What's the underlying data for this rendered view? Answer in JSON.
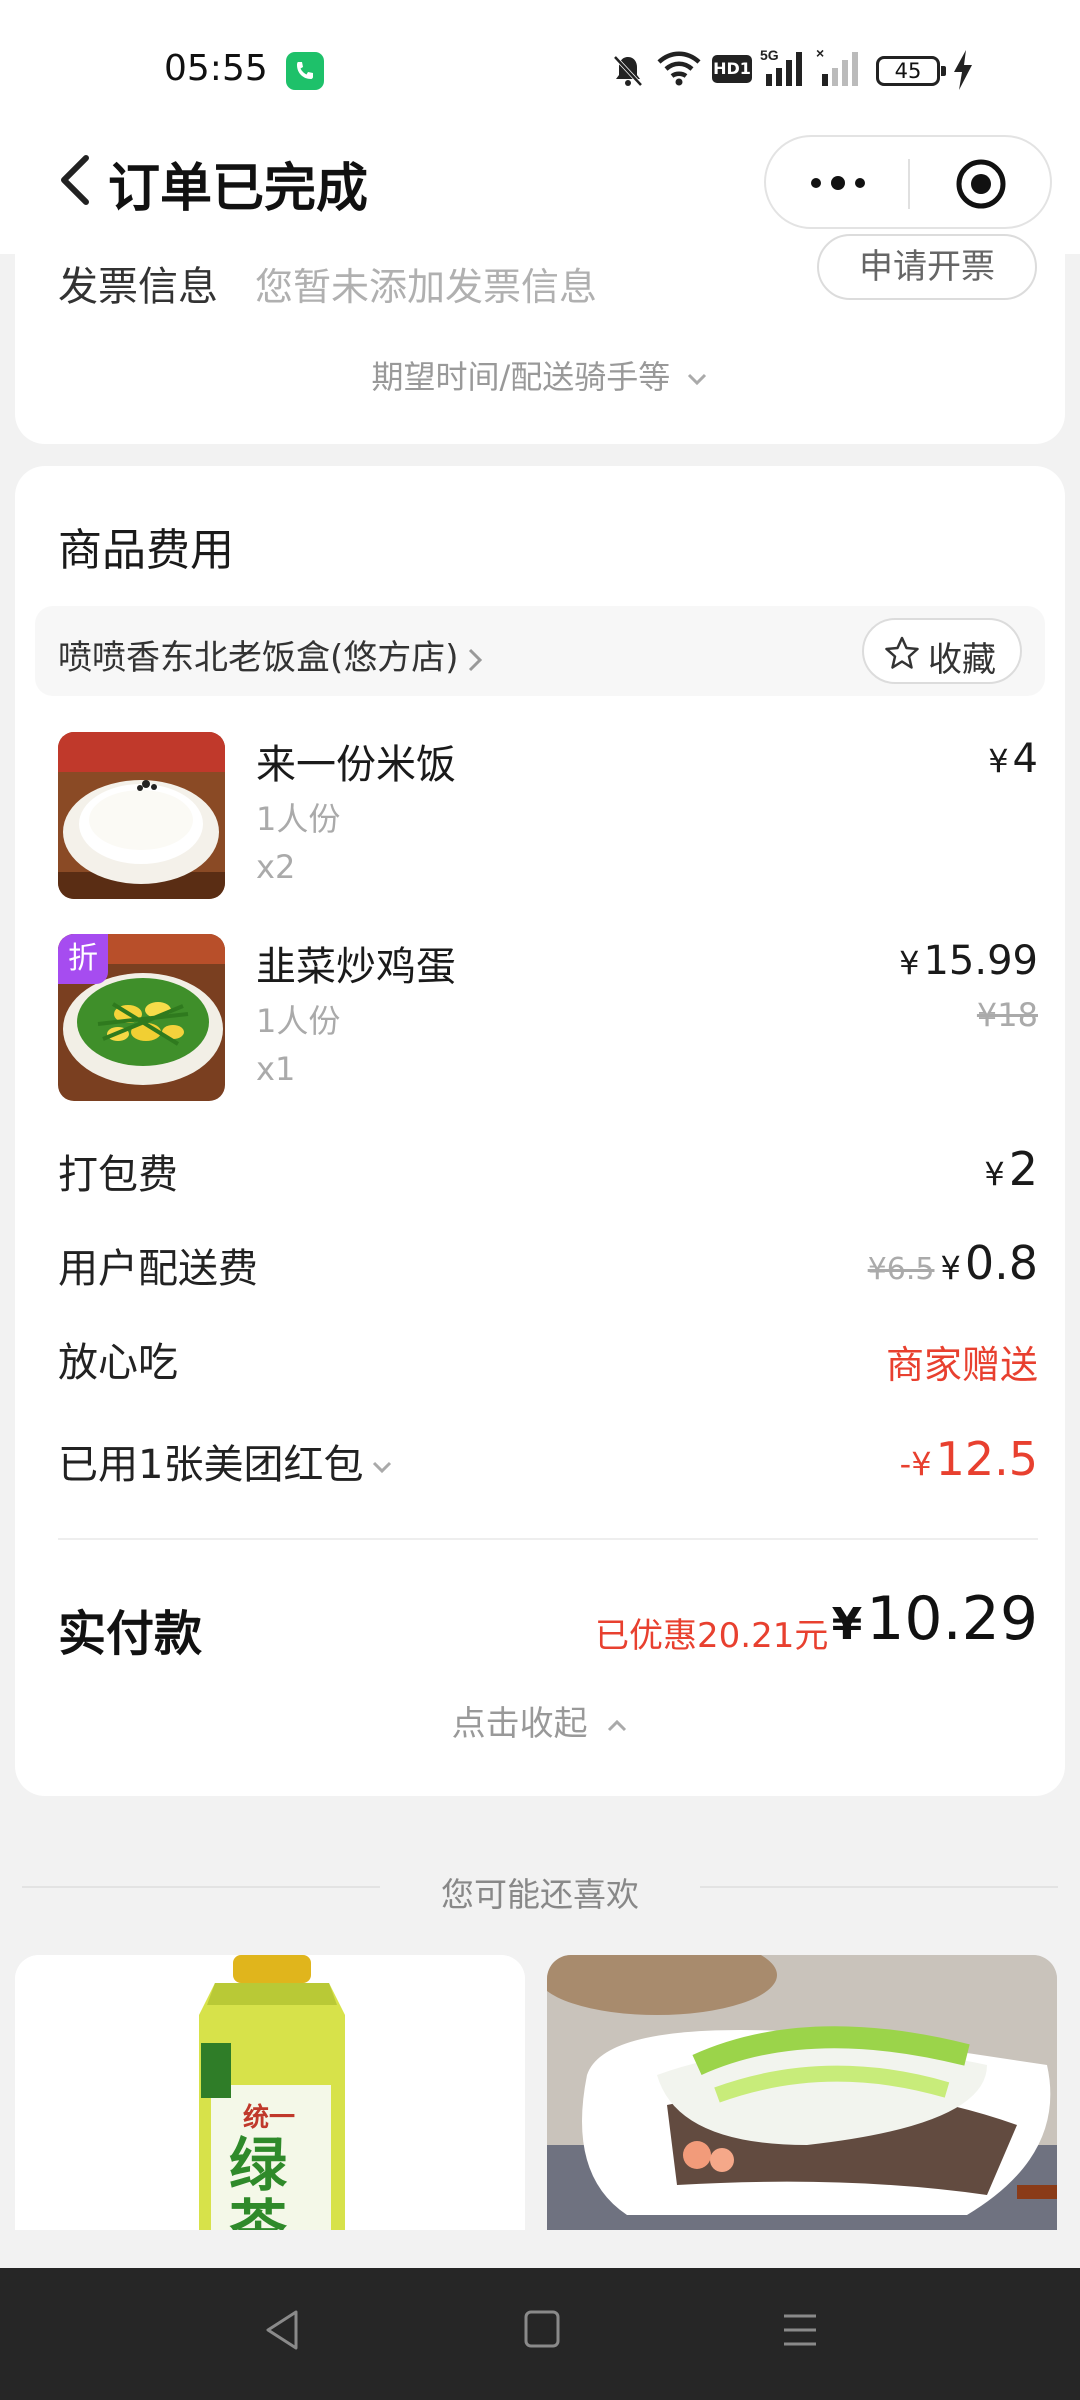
{
  "status_bar": {
    "time": "05:55",
    "battery": "45",
    "network": "5G",
    "hd_label": "HD1"
  },
  "nav": {
    "title": "订单已完成"
  },
  "invoice": {
    "label": "发票信息",
    "placeholder": "您暂未添加发票信息",
    "button": "申请开票",
    "expect_link": "期望时间/配送骑手等"
  },
  "goods": {
    "section_title": "商品费用",
    "shop_name": "喷喷香东北老饭盒(悠方店)",
    "favorite_label": "收藏",
    "items": [
      {
        "name": "来一份米饭",
        "spec": "1人份",
        "qty": "x2",
        "price": "4",
        "currency": "¥"
      },
      {
        "name": "韭菜炒鸡蛋",
        "spec": "1人份",
        "qty": "x1",
        "price": "15.99",
        "original_price": "¥18",
        "currency": "¥",
        "tag": "折"
      }
    ]
  },
  "fees": {
    "packing_label": "打包费",
    "packing_value": "2",
    "delivery_label": "用户配送费",
    "delivery_old": "¥6.5",
    "delivery_value": "0.8",
    "safe_label": "放心吃",
    "safe_value": "商家赠送",
    "redpacket_label": "已用1张美团红包",
    "redpacket_prefix": "-¥",
    "redpacket_value": "12.5",
    "currency": "¥"
  },
  "total": {
    "label": "实付款",
    "saved": "已优惠20.21元",
    "currency": "¥",
    "amount": "10.29",
    "collapse_label": "点击收起"
  },
  "recommend": {
    "title": "您可能还喜欢",
    "items": [
      {
        "product": "统一绿茶",
        "brand_text": "统一",
        "name_text": "绿茶"
      },
      {
        "product": "rice-roll-dish"
      }
    ]
  },
  "colors": {
    "accent_red": "#e8402f",
    "discount_purple": "#a64cf0",
    "call_green": "#1ec16a"
  }
}
